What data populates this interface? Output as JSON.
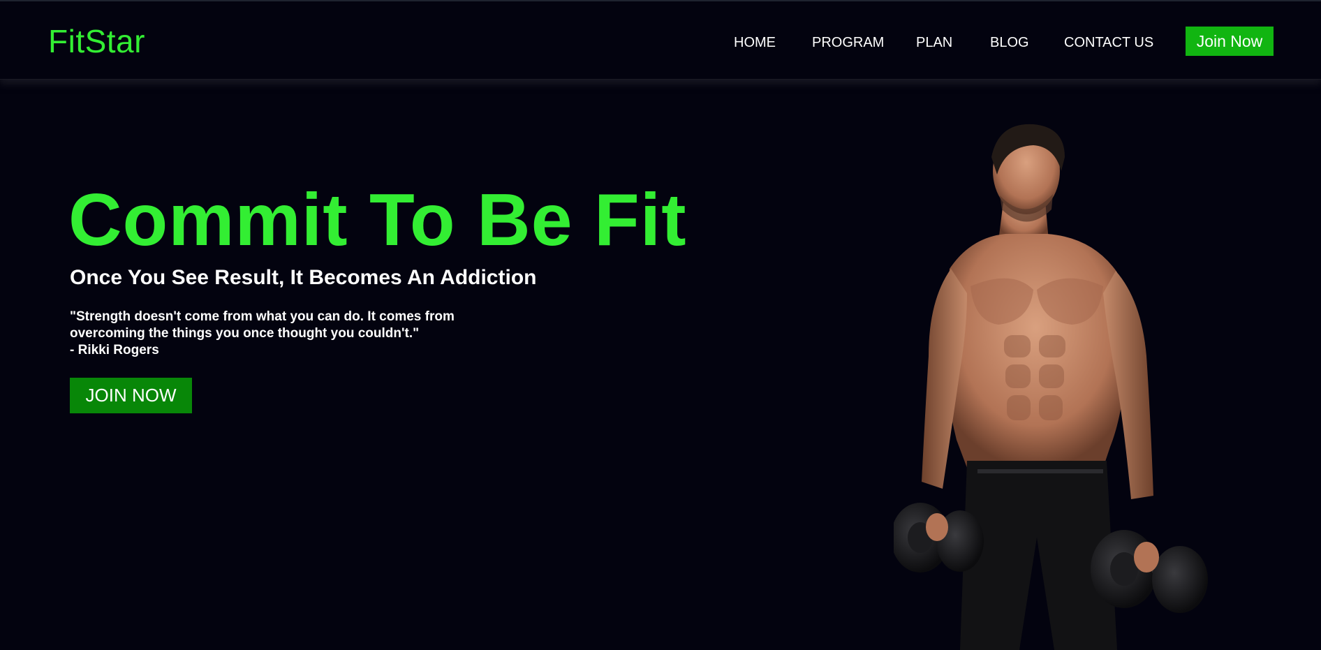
{
  "brand": {
    "logo_text": "FitStar"
  },
  "nav": {
    "items": [
      {
        "label": "HOME"
      },
      {
        "label": "PROGRAM"
      },
      {
        "label": "PLAN"
      },
      {
        "label": "BLOG"
      },
      {
        "label": "CONTACT US"
      }
    ],
    "cta_label": "Join Now"
  },
  "hero": {
    "title": "Commit To Be Fit",
    "subtitle": "Once You See Result, It Becomes An Addiction",
    "quote_lines": [
      "\"Strength doesn't come from what you can do. It comes from",
      "overcoming the things you once thought you couldn't.\"",
      "- Rikki Rogers"
    ],
    "cta_label": "JOIN NOW"
  },
  "colors": {
    "background": "#03030f",
    "accent_green": "#33ee33",
    "nav_button_green": "#11b511",
    "hero_button_green": "#088708",
    "text": "#ffffff"
  }
}
